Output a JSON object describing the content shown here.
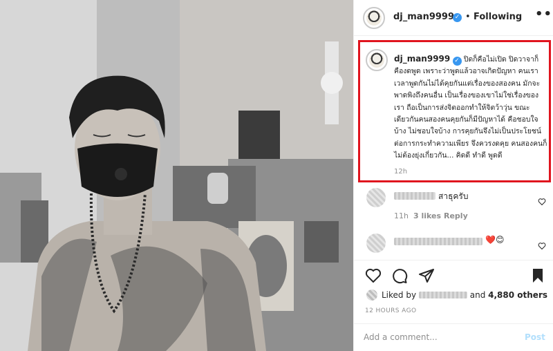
{
  "post": {
    "username": "dj_man9999",
    "dot": "•",
    "follow_status": "Following",
    "more_glyph": "•••"
  },
  "caption": {
    "username": "dj_man9999",
    "text": "ปิดก็คือไม่เปิด  ปิดวาจาก็คืองดพูด เพราะว่าพูดแล้วอาจเกิดปัญหา  คนเราเวลาพูดกันไม่ได้คุยกันแต่เรื่องของสองคน  มักจะพาดพิงถึงคนอื่น  เป็นเรื่องของเขาไม่ใช่เรื่องของเรา  ถือเป็นการส่งจิตออกทำให้จิตว้าวุ่น  ขณะเดียวกันคนสองคนคุยกันก็มีปัญหาได้  คือชอบใจบ้าง  ไม่ชอบใจบ้าง การคุยกันจึงไม่เป็นประโยชน์ต่อการกระทำความเพียร  จึงควรงดคุย  คนสองคนก็ไม่ต้องยุ่งเกี่ยวกัน...  คิดดี  ทำดี  พูดดี",
    "time": "12h"
  },
  "comments": [
    {
      "text": "สาธุครับ",
      "time": "11h",
      "likes": "3 likes",
      "reply": "Reply"
    },
    {
      "text": "❤️😊"
    }
  ],
  "likes": {
    "prefix": "Liked by",
    "suffix": "and",
    "count": "4,880 others"
  },
  "timestamp": "12 HOURS AGO",
  "add_comment": {
    "placeholder": "Add a comment...",
    "post_label": "Post"
  },
  "colors": {
    "highlight_border": "#e0141e",
    "verified_blue": "#3897f0",
    "post_disabled": "#b2dffc",
    "heart_red": "#ed4956"
  }
}
